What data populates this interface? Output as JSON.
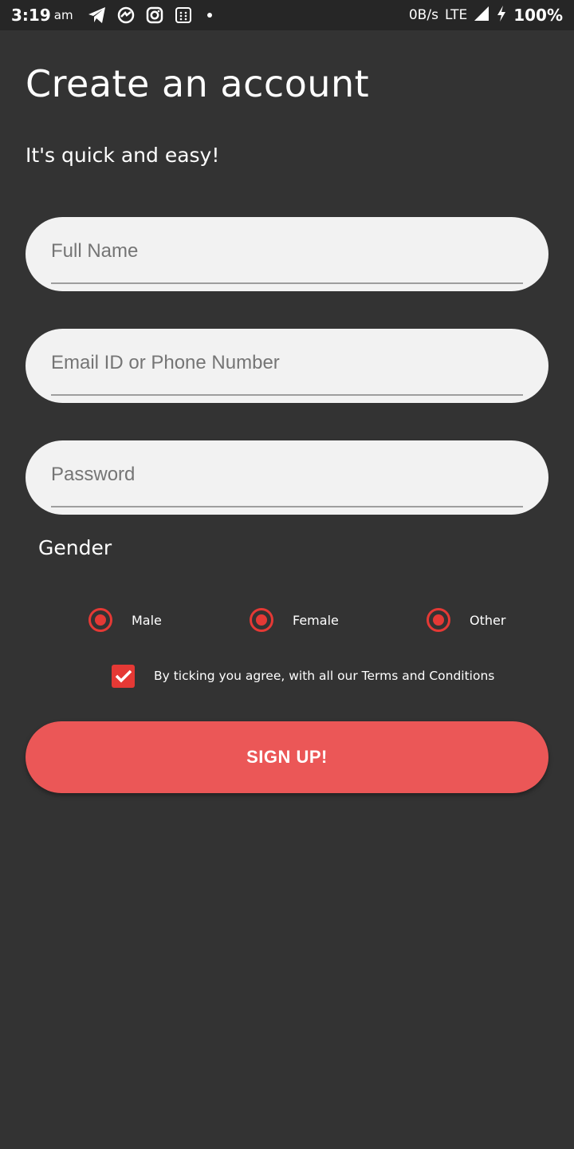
{
  "status_bar": {
    "time": "3:19",
    "ampm": "am",
    "speed": "0B/s",
    "network": "LTE",
    "battery": "100%",
    "icons": [
      "telegram-icon",
      "messenger-icon",
      "instagram-icon",
      "app-grid-icon",
      "notification-dot-icon",
      "signal-icon",
      "charging-icon"
    ]
  },
  "page": {
    "title": "Create an account",
    "subtitle": "It's quick and easy!"
  },
  "form": {
    "full_name": {
      "placeholder": "Full Name",
      "value": ""
    },
    "email": {
      "placeholder": "Email ID or Phone Number",
      "value": ""
    },
    "password": {
      "placeholder": "Password",
      "value": ""
    },
    "gender_label": "Gender",
    "gender_options": [
      "Male",
      "Female",
      "Other"
    ],
    "terms_text": "By ticking you agree, with all our Terms and Conditions",
    "terms_checked": true,
    "submit_label": "SIGN UP!"
  },
  "colors": {
    "background": "#333333",
    "status_bar": "#262626",
    "field_bg": "#f2f2f2",
    "accent": "#e53935",
    "button": "#eb5757"
  }
}
